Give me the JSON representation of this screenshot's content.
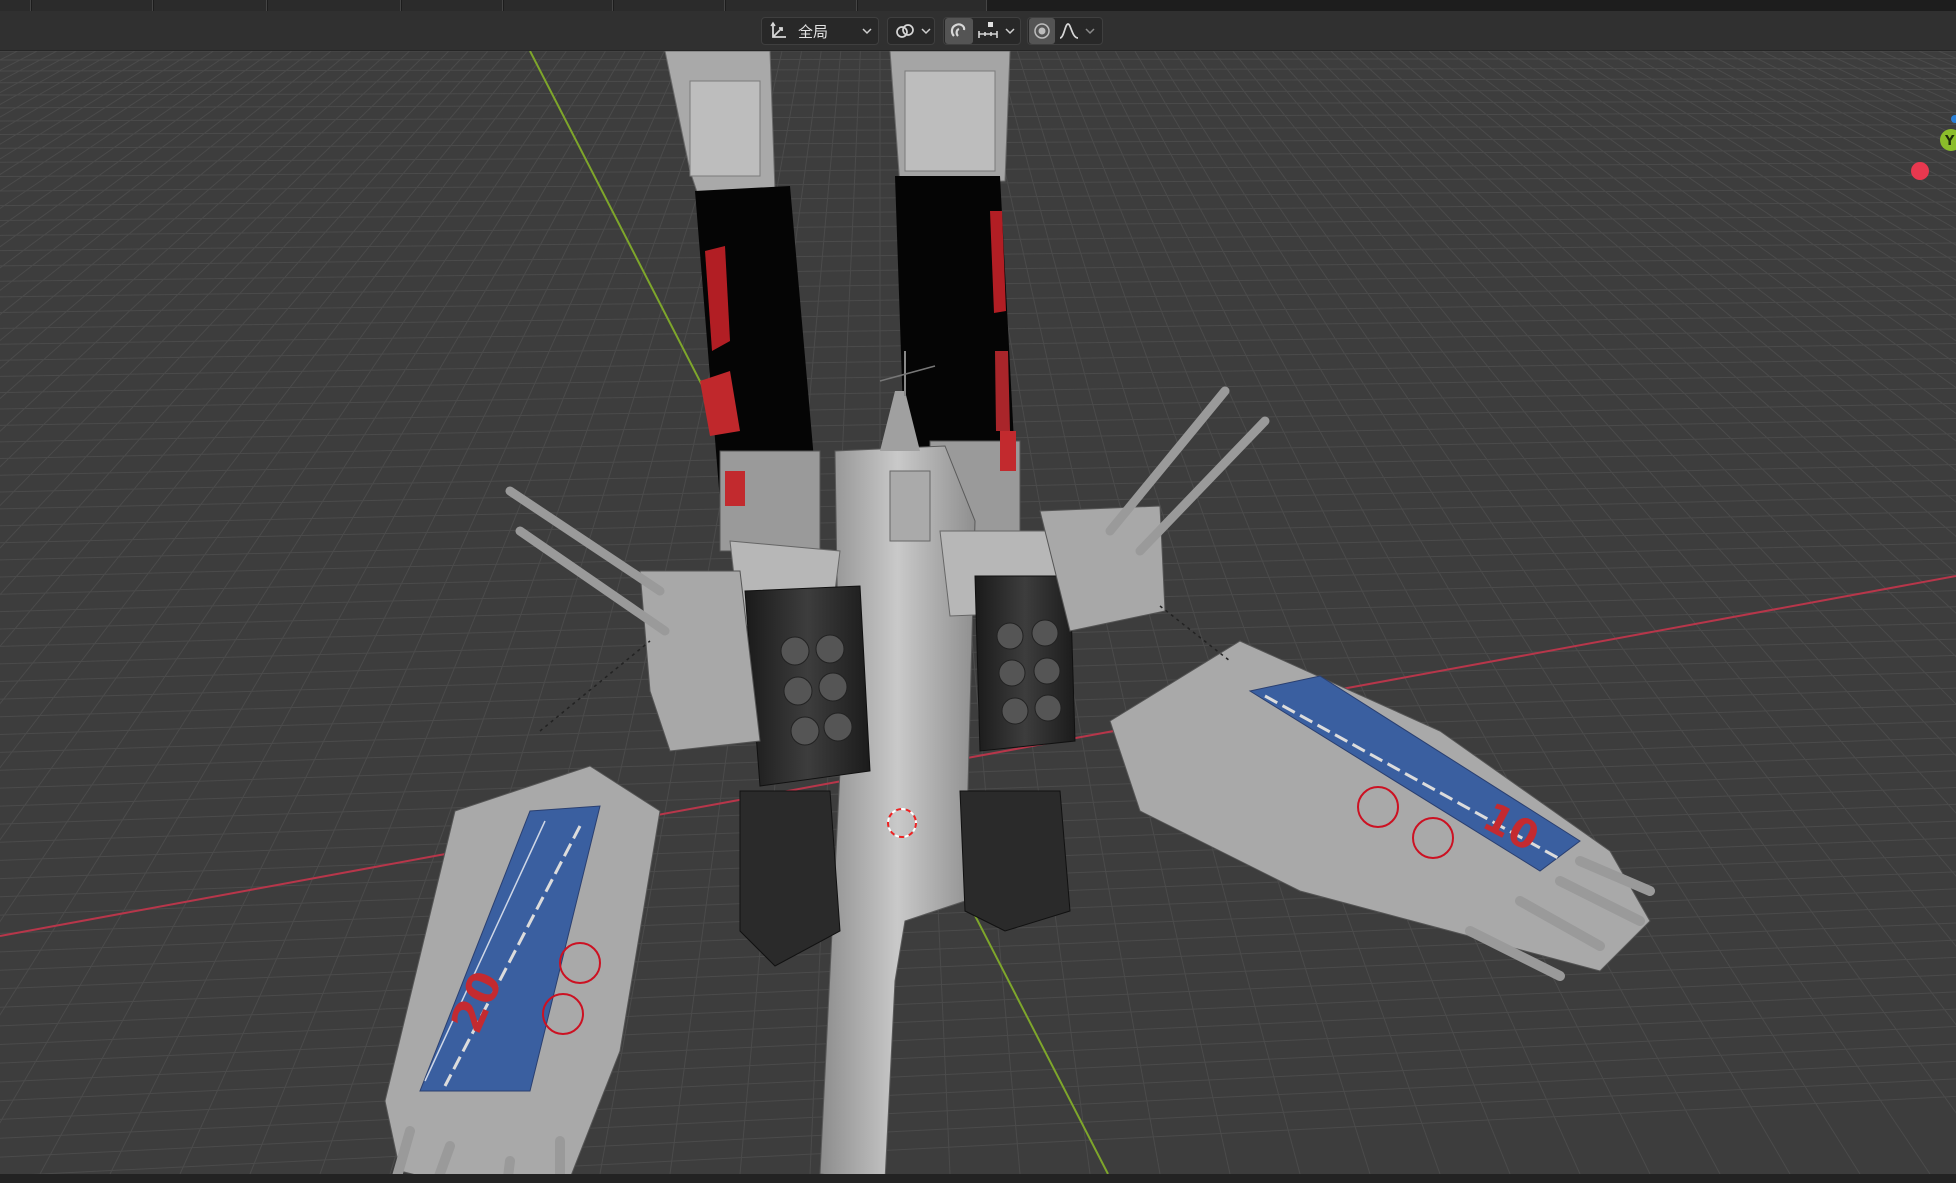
{
  "header": {
    "transform_orientation": {
      "label": "全局",
      "icon": "transform-orientation-icon"
    },
    "pivot": {
      "icon": "pivot-point-icon"
    },
    "snap": {
      "icon": "snap-magnet-icon",
      "element_icon": "snap-increment-icon"
    },
    "proportional": {
      "icon": "proportional-edit-icon",
      "falloff_icon": "falloff-curve-icon"
    }
  },
  "viewport": {
    "navigation_gizmo": {
      "axes": [
        "Y"
      ],
      "colors": {
        "x": "#e8384f",
        "y": "#8bbd2a",
        "z": "#2a7fd6"
      }
    },
    "colors": {
      "background": "#3d3d3d",
      "grid": "#4a4a4a",
      "x_axis": "#b7364a",
      "y_axis": "#7ea62b"
    }
  }
}
